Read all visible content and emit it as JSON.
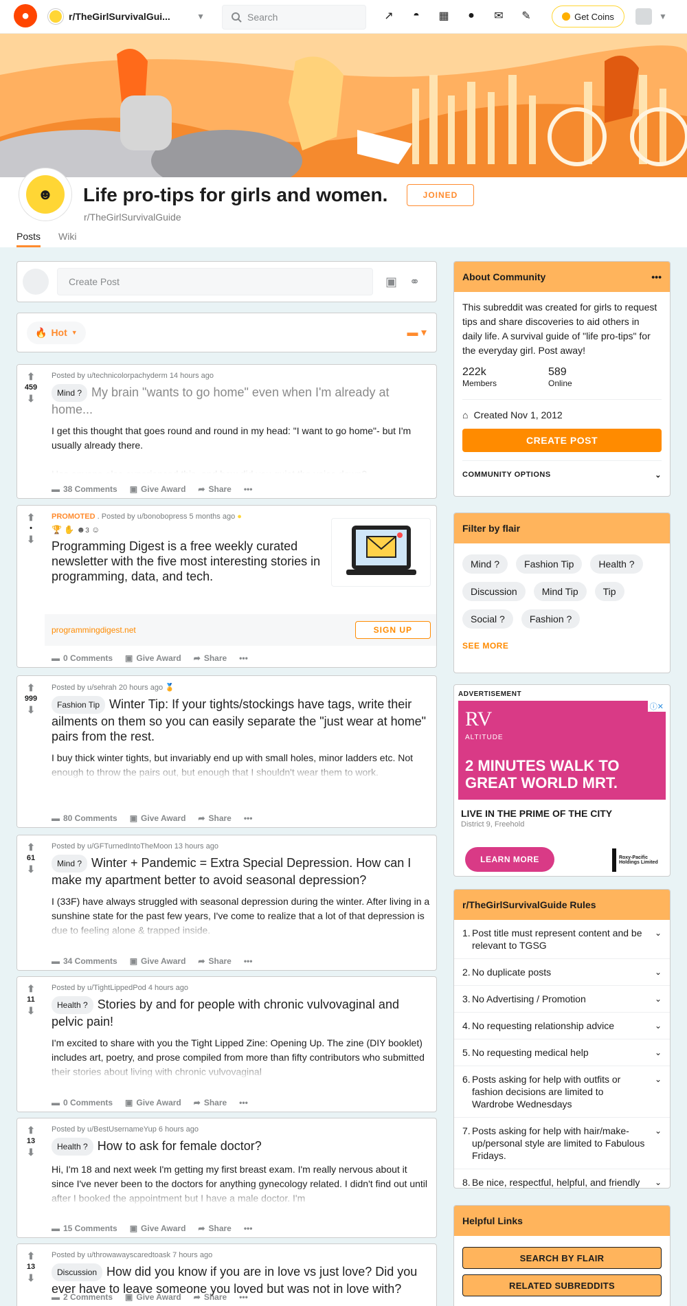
{
  "header": {
    "community": "r/TheGirlSurvivalGui...",
    "search_placeholder": "Search",
    "coins_label": "Get Coins"
  },
  "community": {
    "title": "Life pro-tips for girls and women.",
    "name": "r/TheGirlSurvivalGuide",
    "joined_label": "JOINED",
    "tabs": [
      {
        "label": "Posts"
      },
      {
        "label": "Wiki"
      }
    ]
  },
  "create_post": {
    "placeholder": "Create Post"
  },
  "sort": {
    "label": "Hot"
  },
  "posts": [
    {
      "votes": "459",
      "meta": "Posted by u/technicolorpachyderm 14 hours ago",
      "flair": "Mind ?",
      "title": "My brain \"wants to go home\" even when I'm already at home...",
      "text": "I get this thought that goes round and round in my head: \"I want to go home\"- but I'm usually already there.\n\nHas anyone else experienced this, and how did you quiet the voice down?",
      "comments": "38 Comments",
      "award": "Give Award",
      "share": "Share"
    },
    {
      "votes": "•",
      "promoted": "PROMOTED",
      "meta": ". Posted by u/bonobopress 5 months ago",
      "title": "Programming Digest is a free weekly curated newsletter with the five most interesting stories in programming, data, and tech.",
      "link": "programmingdigest.net",
      "cta": "SIGN UP",
      "award_count": "3",
      "comments": "0 Comments",
      "award": "Give Award",
      "share": "Share"
    },
    {
      "votes": "999",
      "meta": "Posted by u/sehrah 20 hours ago",
      "flair": "Fashion Tip",
      "title": "Winter Tip: If your tights/stockings have tags, write their ailments on them so you can easily separate the \"just wear at home\" pairs from the rest.",
      "text": "I buy thick winter tights, but invariably end up with small holes, minor ladders etc. Not enough to throw the pairs out, but enough that I shouldn't wear them to work.",
      "comments": "80 Comments",
      "award": "Give Award",
      "share": "Share"
    },
    {
      "votes": "61",
      "meta": "Posted by u/GFTurnedIntoTheMoon 13 hours ago",
      "flair": "Mind ?",
      "title": "Winter + Pandemic = Extra Special Depression. How can I make my apartment better to avoid seasonal depression?",
      "text": "I (33F) have always struggled with seasonal depression during the winter. After living in a sunshine state for the past few years, I've come to realize that a lot of that depression is due to feeling alone & trapped inside.",
      "comments": "34 Comments",
      "award": "Give Award",
      "share": "Share"
    },
    {
      "votes": "11",
      "meta": "Posted by u/TightLippedPod 4 hours ago",
      "flair": "Health ?",
      "title": "Stories by and for people with chronic vulvovaginal and pelvic pain!",
      "text": "I'm excited to share with you the Tight Lipped Zine: Opening Up. The zine (DIY booklet) includes art, poetry, and prose compiled from more than fifty contributors who submitted their stories about living with chronic vulvovaginal",
      "comments": "0 Comments",
      "award": "Give Award",
      "share": "Share"
    },
    {
      "votes": "13",
      "meta": "Posted by u/BestUsernameYup 6 hours ago",
      "flair": "Health ?",
      "title": "How to ask for female doctor?",
      "text": "Hi, I'm 18 and next week I'm getting my first breast exam. I'm really nervous about it since I've never been to the doctors for anything gynecology related. I didn't find out until after I booked the appointment but I have a male doctor. I'm",
      "comments": "15 Comments",
      "award": "Give Award",
      "share": "Share"
    },
    {
      "votes": "13",
      "meta": "Posted by u/throwawayscaredtoask 7 hours ago",
      "flair": "Discussion",
      "title": "How did you know if you are in love vs just love? Did you ever have to leave someone you loved but was not in love with?",
      "comments": "2 Comments",
      "award": "Give Award",
      "share": "Share"
    }
  ],
  "about": {
    "header": "About Community",
    "description": "This subreddit was created for girls to request tips and share discoveries to aid others in daily life. A survival guide of \"life pro-tips\" for the everyday girl. Post away!",
    "members": "222k",
    "members_label": "Members",
    "online": "589",
    "online_label": "Online",
    "created": "Created Nov 1, 2012",
    "create_post": "CREATE POST",
    "options": "COMMUNITY OPTIONS"
  },
  "flair_filter": {
    "header": "Filter by flair",
    "flairs": [
      "Mind ?",
      "Fashion Tip",
      "Health ?",
      "Discussion",
      "Mind Tip",
      "Tip",
      "Social ?",
      "Fashion ?"
    ],
    "see_more": "SEE MORE"
  },
  "ad": {
    "label": "ADVERTISEMENT",
    "brand": "RV",
    "brand_sub": "ALTITUDE",
    "headline": "2 MINUTES WALK TO GREAT WORLD MRT.",
    "title": "LIVE IN THE PRIME OF THE CITY",
    "subtitle": "District 9, Freehold",
    "cta": "LEARN MORE",
    "sponsor": "Roxy-Pacific Holdings Limited"
  },
  "rules": {
    "header": "r/TheGirlSurvivalGuide Rules",
    "items": [
      {
        "n": "1.",
        "text": "Post title must represent content and be relevant to TGSG"
      },
      {
        "n": "2.",
        "text": "No duplicate posts"
      },
      {
        "n": "3.",
        "text": "No Advertising / Promotion"
      },
      {
        "n": "4.",
        "text": "No requesting relationship advice"
      },
      {
        "n": "5.",
        "text": "No requesting medical help"
      },
      {
        "n": "6.",
        "text": "Posts asking for help with outfits or fashion decisions are limited to Wardrobe Wednesdays"
      },
      {
        "n": "7.",
        "text": "Posts asking for help with hair/make-up/personal style are limited to Fabulous Fridays."
      },
      {
        "n": "8.",
        "text": "Be nice, respectful, helpful, and friendly"
      }
    ]
  },
  "links": {
    "header": "Helpful Links",
    "buttons": [
      "SEARCH BY FLAIR",
      "RELATED SUBREDDITS"
    ]
  },
  "colors": {
    "accent": "#ff8b2e",
    "sidebar_header": "#ffb45c",
    "reddit": "#ff4500",
    "ad": "#d93a86"
  }
}
